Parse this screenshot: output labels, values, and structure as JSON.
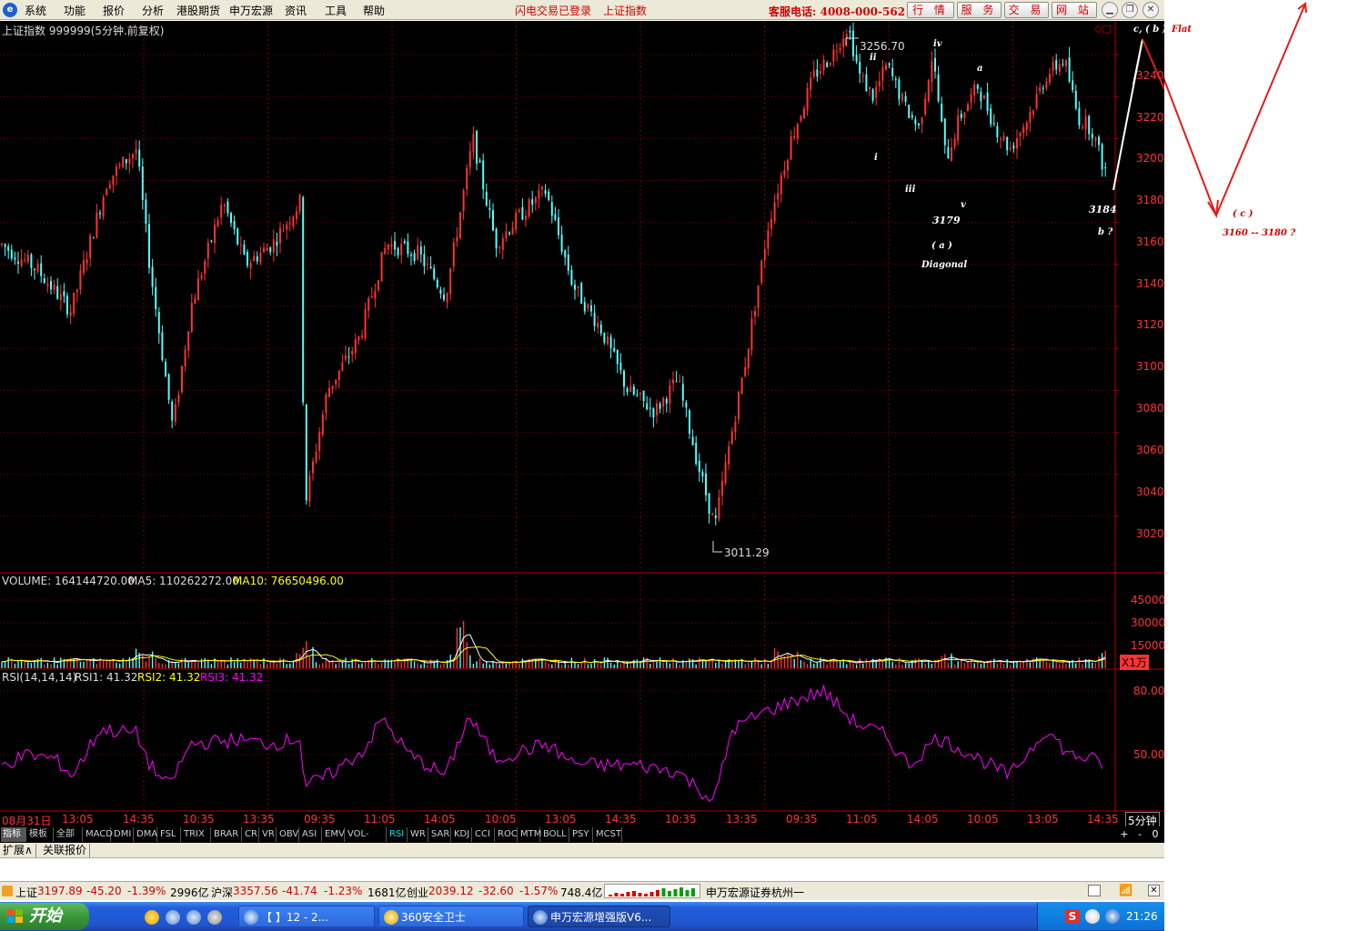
{
  "menu": {
    "items": [
      "系统",
      "功能",
      "报价",
      "分析",
      "港股期货",
      "申万宏源",
      "资讯",
      "工具",
      "帮助"
    ],
    "status_login": "闪电交易已登录",
    "status_index": "上证指数",
    "hotline": "客服电话: 4008-000-562",
    "top_buttons": [
      "行 情",
      "服 务",
      "交 易",
      "网 站"
    ]
  },
  "chart": {
    "title": "上证指数 999999(5分钟.前复权)",
    "high_label": "3256.70",
    "low_label": "3011.29",
    "price_axis": [
      "3240",
      "3220",
      "3200",
      "3180",
      "3160",
      "3140",
      "3120",
      "3100",
      "3080",
      "3060",
      "3040",
      "3020"
    ],
    "annotations": {
      "ii": "ii",
      "iv": "iv",
      "i": "i",
      "iii": "iii",
      "v": "v",
      "a": "a",
      "c_b": "c, ( b )",
      "flat": "Flat",
      "v3179": "3179",
      "a_paren": "( a )",
      "diagonal": "Diagonal",
      "v3184": "3184",
      "b_q": "b ?",
      "c_paren": "( c )",
      "target": "3160 -- 3180 ?"
    }
  },
  "volume": {
    "label": "VOLUME: 164144720.00",
    "ma5": "MA5: 110262272.00",
    "ma10": "MA10: 76650496.00",
    "axis": [
      "45000",
      "30000",
      "15000"
    ],
    "unit": "X1万"
  },
  "rsi": {
    "label": "RSI(14,14,14)",
    "rsi1": "RSI1: 41.32",
    "rsi2": "RSI2: 41.32",
    "rsi3": "RSI3: 41.32",
    "axis": [
      "80.00",
      "50.00"
    ]
  },
  "time_axis": {
    "labels": [
      "08月31日",
      "13:05",
      "14:35",
      "10:35",
      "13:35",
      "09:35",
      "11:05",
      "14:05",
      "10:05",
      "13:05",
      "14:35",
      "10:35",
      "13:35",
      "09:35",
      "11:05",
      "14:05",
      "10:05",
      "13:05",
      "14:35"
    ],
    "period": "5分钟"
  },
  "indicator_tabs": [
    "指标",
    "模板",
    "全部",
    "MACD",
    "DMI",
    "DMA",
    "FSL",
    "TRIX",
    "BRAR",
    "CR",
    "VR",
    "OBV",
    "ASI",
    "EMV",
    "VOL-TDX",
    "RSI",
    "WR",
    "SAR",
    "KDJ",
    "CCI",
    "ROC",
    "MTM",
    "BOLL",
    "PSY",
    "MCST"
  ],
  "active_tab": "RSI",
  "tab_controls": [
    "+",
    "-",
    "0"
  ],
  "sub_tabs": [
    "扩展∧",
    "关联报价"
  ],
  "statusbar": {
    "sh_name": "上证",
    "sh_val": "3197.89",
    "sh_chg": "-45.20",
    "sh_pct": "-1.39%",
    "sh_amt": "2996亿",
    "hs_name": "沪深",
    "hs_val": "3357.56",
    "hs_chg": "-41.74",
    "hs_pct": "-1.23%",
    "hs_amt": "1681亿",
    "cy_name": "创业",
    "cy_val": "2039.12",
    "cy_chg": "-32.60",
    "cy_pct": "-1.57%",
    "cy_amt": "748.4亿",
    "broker": "申万宏源证券杭州一"
  },
  "taskbar": {
    "start": "开始",
    "tasks": [
      "【        】12 - 2...",
      "360安全卫士",
      "申万宏源增强版V6..."
    ],
    "clock": "21:26",
    "tray_letter": "S"
  },
  "colors": {
    "up": "#ff3232",
    "down": "#54ffff",
    "ma5": "#ffffff",
    "ma10": "#ffff00",
    "rsi_line": "#ff00ff",
    "grid": "#8b0000"
  }
}
